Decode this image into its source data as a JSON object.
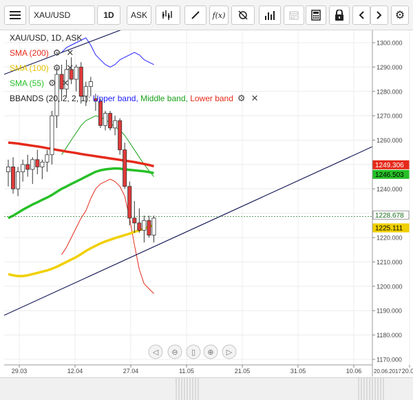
{
  "toolbar": {
    "menu_icon": "hamburger-icon",
    "symbol_value": "XAU/USD",
    "timeframe": "1D",
    "price_type": "ASK",
    "buttons": [
      "candle-type-icon",
      "drawing-pen-icon",
      "function-fx-icon",
      "crosshair-target-icon",
      "bar-chart-icon",
      "calendar-icon",
      "calculator-icon",
      "lock-icon",
      "chevron-left-icon",
      "chevron-right-icon",
      "gear-icon"
    ],
    "fx_label": "f(x)"
  },
  "legend": {
    "title": "XAU/USD, 1D, ASK",
    "sma200": "SMA (200)",
    "sma100": "SMA (100)",
    "sma55": "SMA (55)",
    "bbands_prefix": "BBANDS (20, 2, 2, 1):",
    "bbands_upper": "Upper band,",
    "bbands_middle": "Middle band,",
    "bbands_lower": "Lower band",
    "settings_glyph": "⚙",
    "remove_glyph": "✕"
  },
  "colors": {
    "sma200": "#e52a1a",
    "sma100": "#f0d000",
    "sma55": "#27c027",
    "bb_upper": "#2020ff",
    "bb_middle": "#18a018",
    "bb_lower": "#e52a1a",
    "bull": "#ffffff",
    "bear": "#e03a3a",
    "trendline": "#1a1f5a"
  },
  "chart_data": {
    "type": "candlestick",
    "symbol": "XAU/USD",
    "interval": "1D",
    "ylim": [
      1168,
      1306
    ],
    "yticks": [
      "1300.000",
      "1290.000",
      "1280.000",
      "1270.000",
      "1260.000",
      "1250.000",
      "1240.000",
      "1230.000",
      "1220.000",
      "1210.000",
      "1200.000",
      "1190.000",
      "1180.000",
      "1170.000"
    ],
    "xticks": [
      "29.03",
      "12.04",
      "27.04",
      "11.05",
      "21.05",
      "31.05",
      "10.06",
      "20.06"
    ],
    "x_corner_label": "20.06.2017",
    "price_badges": [
      {
        "label": "1249.306",
        "value": 1249.306,
        "series": "sma200"
      },
      {
        "label": "1246.503",
        "value": 1246.503,
        "series": "sma55"
      },
      {
        "label": "1228.678",
        "value": 1228.678,
        "series": "last"
      },
      {
        "label": "1225.111",
        "value": 1225.111,
        "series": "sma100"
      }
    ],
    "candles": [
      {
        "o": 1247,
        "h": 1252,
        "l": 1241,
        "c": 1249
      },
      {
        "o": 1249,
        "h": 1253,
        "l": 1238,
        "c": 1240
      },
      {
        "o": 1240,
        "h": 1249,
        "l": 1237,
        "c": 1247
      },
      {
        "o": 1247,
        "h": 1252,
        "l": 1243,
        "c": 1250
      },
      {
        "o": 1250,
        "h": 1254,
        "l": 1245,
        "c": 1248
      },
      {
        "o": 1248,
        "h": 1253,
        "l": 1242,
        "c": 1252
      },
      {
        "o": 1252,
        "h": 1256,
        "l": 1246,
        "c": 1249
      },
      {
        "o": 1249,
        "h": 1252,
        "l": 1244,
        "c": 1251
      },
      {
        "o": 1251,
        "h": 1256,
        "l": 1247,
        "c": 1254
      },
      {
        "o": 1254,
        "h": 1272,
        "l": 1250,
        "c": 1270
      },
      {
        "o": 1270,
        "h": 1290,
        "l": 1265,
        "c": 1287
      },
      {
        "o": 1287,
        "h": 1291,
        "l": 1276,
        "c": 1281
      },
      {
        "o": 1281,
        "h": 1293,
        "l": 1278,
        "c": 1289
      },
      {
        "o": 1289,
        "h": 1294,
        "l": 1283,
        "c": 1285
      },
      {
        "o": 1285,
        "h": 1291,
        "l": 1280,
        "c": 1290
      },
      {
        "o": 1290,
        "h": 1292,
        "l": 1275,
        "c": 1278
      },
      {
        "o": 1278,
        "h": 1284,
        "l": 1274,
        "c": 1282
      },
      {
        "o": 1282,
        "h": 1286,
        "l": 1278,
        "c": 1284
      },
      {
        "o": 1277,
        "h": 1279,
        "l": 1272,
        "c": 1276
      },
      {
        "o": 1276,
        "h": 1277,
        "l": 1265,
        "c": 1266
      },
      {
        "o": 1266,
        "h": 1272,
        "l": 1264,
        "c": 1271
      },
      {
        "o": 1271,
        "h": 1272,
        "l": 1264,
        "c": 1265
      },
      {
        "o": 1265,
        "h": 1270,
        "l": 1262,
        "c": 1268
      },
      {
        "o": 1268,
        "h": 1269,
        "l": 1254,
        "c": 1256
      },
      {
        "o": 1256,
        "h": 1259,
        "l": 1240,
        "c": 1241
      },
      {
        "o": 1241,
        "h": 1243,
        "l": 1225,
        "c": 1228
      },
      {
        "o": 1228,
        "h": 1235,
        "l": 1222,
        "c": 1226
      },
      {
        "o": 1226,
        "h": 1232,
        "l": 1222,
        "c": 1223
      },
      {
        "o": 1223,
        "h": 1229,
        "l": 1218,
        "c": 1227
      },
      {
        "o": 1227,
        "h": 1229,
        "l": 1220,
        "c": 1221
      },
      {
        "o": 1221,
        "h": 1229,
        "l": 1218,
        "c": 1228
      }
    ],
    "sma200": [
      1259,
      1258.8,
      1258.6,
      1258.3,
      1258,
      1257.7,
      1257.4,
      1257.1,
      1256.7,
      1256.4,
      1256,
      1255.7,
      1255.3,
      1255,
      1254.7,
      1254.3,
      1254,
      1253.7,
      1253.4,
      1253.1,
      1252.8,
      1252.5,
      1252.2,
      1251.9,
      1251.6,
      1251.3,
      1251,
      1250.6,
      1250.2,
      1249.8,
      1249.3
    ],
    "sma100": [
      1205,
      1204.5,
      1204.2,
      1204.2,
      1204.5,
      1205,
      1205.5,
      1206,
      1206.5,
      1207.2,
      1208,
      1209,
      1210,
      1211,
      1212,
      1213.2,
      1214.5,
      1215.6,
      1216.6,
      1217.6,
      1218.4,
      1219.1,
      1219.8,
      1220.4,
      1221,
      1221.6,
      1222.3,
      1223,
      1223.7,
      1224.4,
      1225.1
    ],
    "sma55": [
      1228,
      1229,
      1230.2,
      1231.4,
      1232.5,
      1233.6,
      1234.5,
      1235.5,
      1236.4,
      1237.5,
      1238.8,
      1240,
      1241,
      1242,
      1243,
      1244,
      1245,
      1246,
      1247,
      1247.6,
      1248,
      1248.2,
      1248.4,
      1248.3,
      1248,
      1247.8,
      1247.6,
      1247.4,
      1247.2,
      1246.9,
      1246.5
    ],
    "bb_upper": [
      null,
      null,
      null,
      null,
      null,
      null,
      null,
      null,
      null,
      null,
      null,
      1296,
      1298,
      1299,
      1300,
      1301,
      1302,
      1299,
      1295,
      1293,
      1291,
      1290,
      1291,
      1293,
      1294,
      1295,
      1296,
      1295,
      1293,
      1292,
      1291
    ],
    "bb_middle": [
      null,
      null,
      null,
      null,
      null,
      null,
      null,
      null,
      null,
      null,
      null,
      1254,
      1257,
      1260,
      1263,
      1266,
      1268,
      1269,
      1270,
      1269.5,
      1268.5,
      1267,
      1265.5,
      1264,
      1262,
      1259,
      1256,
      1253,
      1250,
      1247.5,
      1245
    ],
    "bb_lower": [
      null,
      null,
      null,
      null,
      null,
      null,
      null,
      null,
      null,
      null,
      null,
      1213,
      1216,
      1220,
      1224,
      1228,
      1231,
      1236,
      1240,
      1242,
      1243,
      1244,
      1243,
      1241,
      1237,
      1228,
      1217,
      1207,
      1201,
      1199,
      1197
    ],
    "trendline_lower": {
      "from": [
        "29.03",
        1189
      ],
      "to": [
        "20.06",
        1257
      ]
    },
    "trendline_upper": {
      "from": [
        "29.03",
        1284
      ],
      "to": [
        "27.04",
        1307
      ]
    }
  },
  "navigator": {
    "buttons": [
      "arrow-left-icon",
      "zoom-out-icon",
      "reset-zoom-icon",
      "zoom-in-icon",
      "arrow-right-icon"
    ]
  }
}
